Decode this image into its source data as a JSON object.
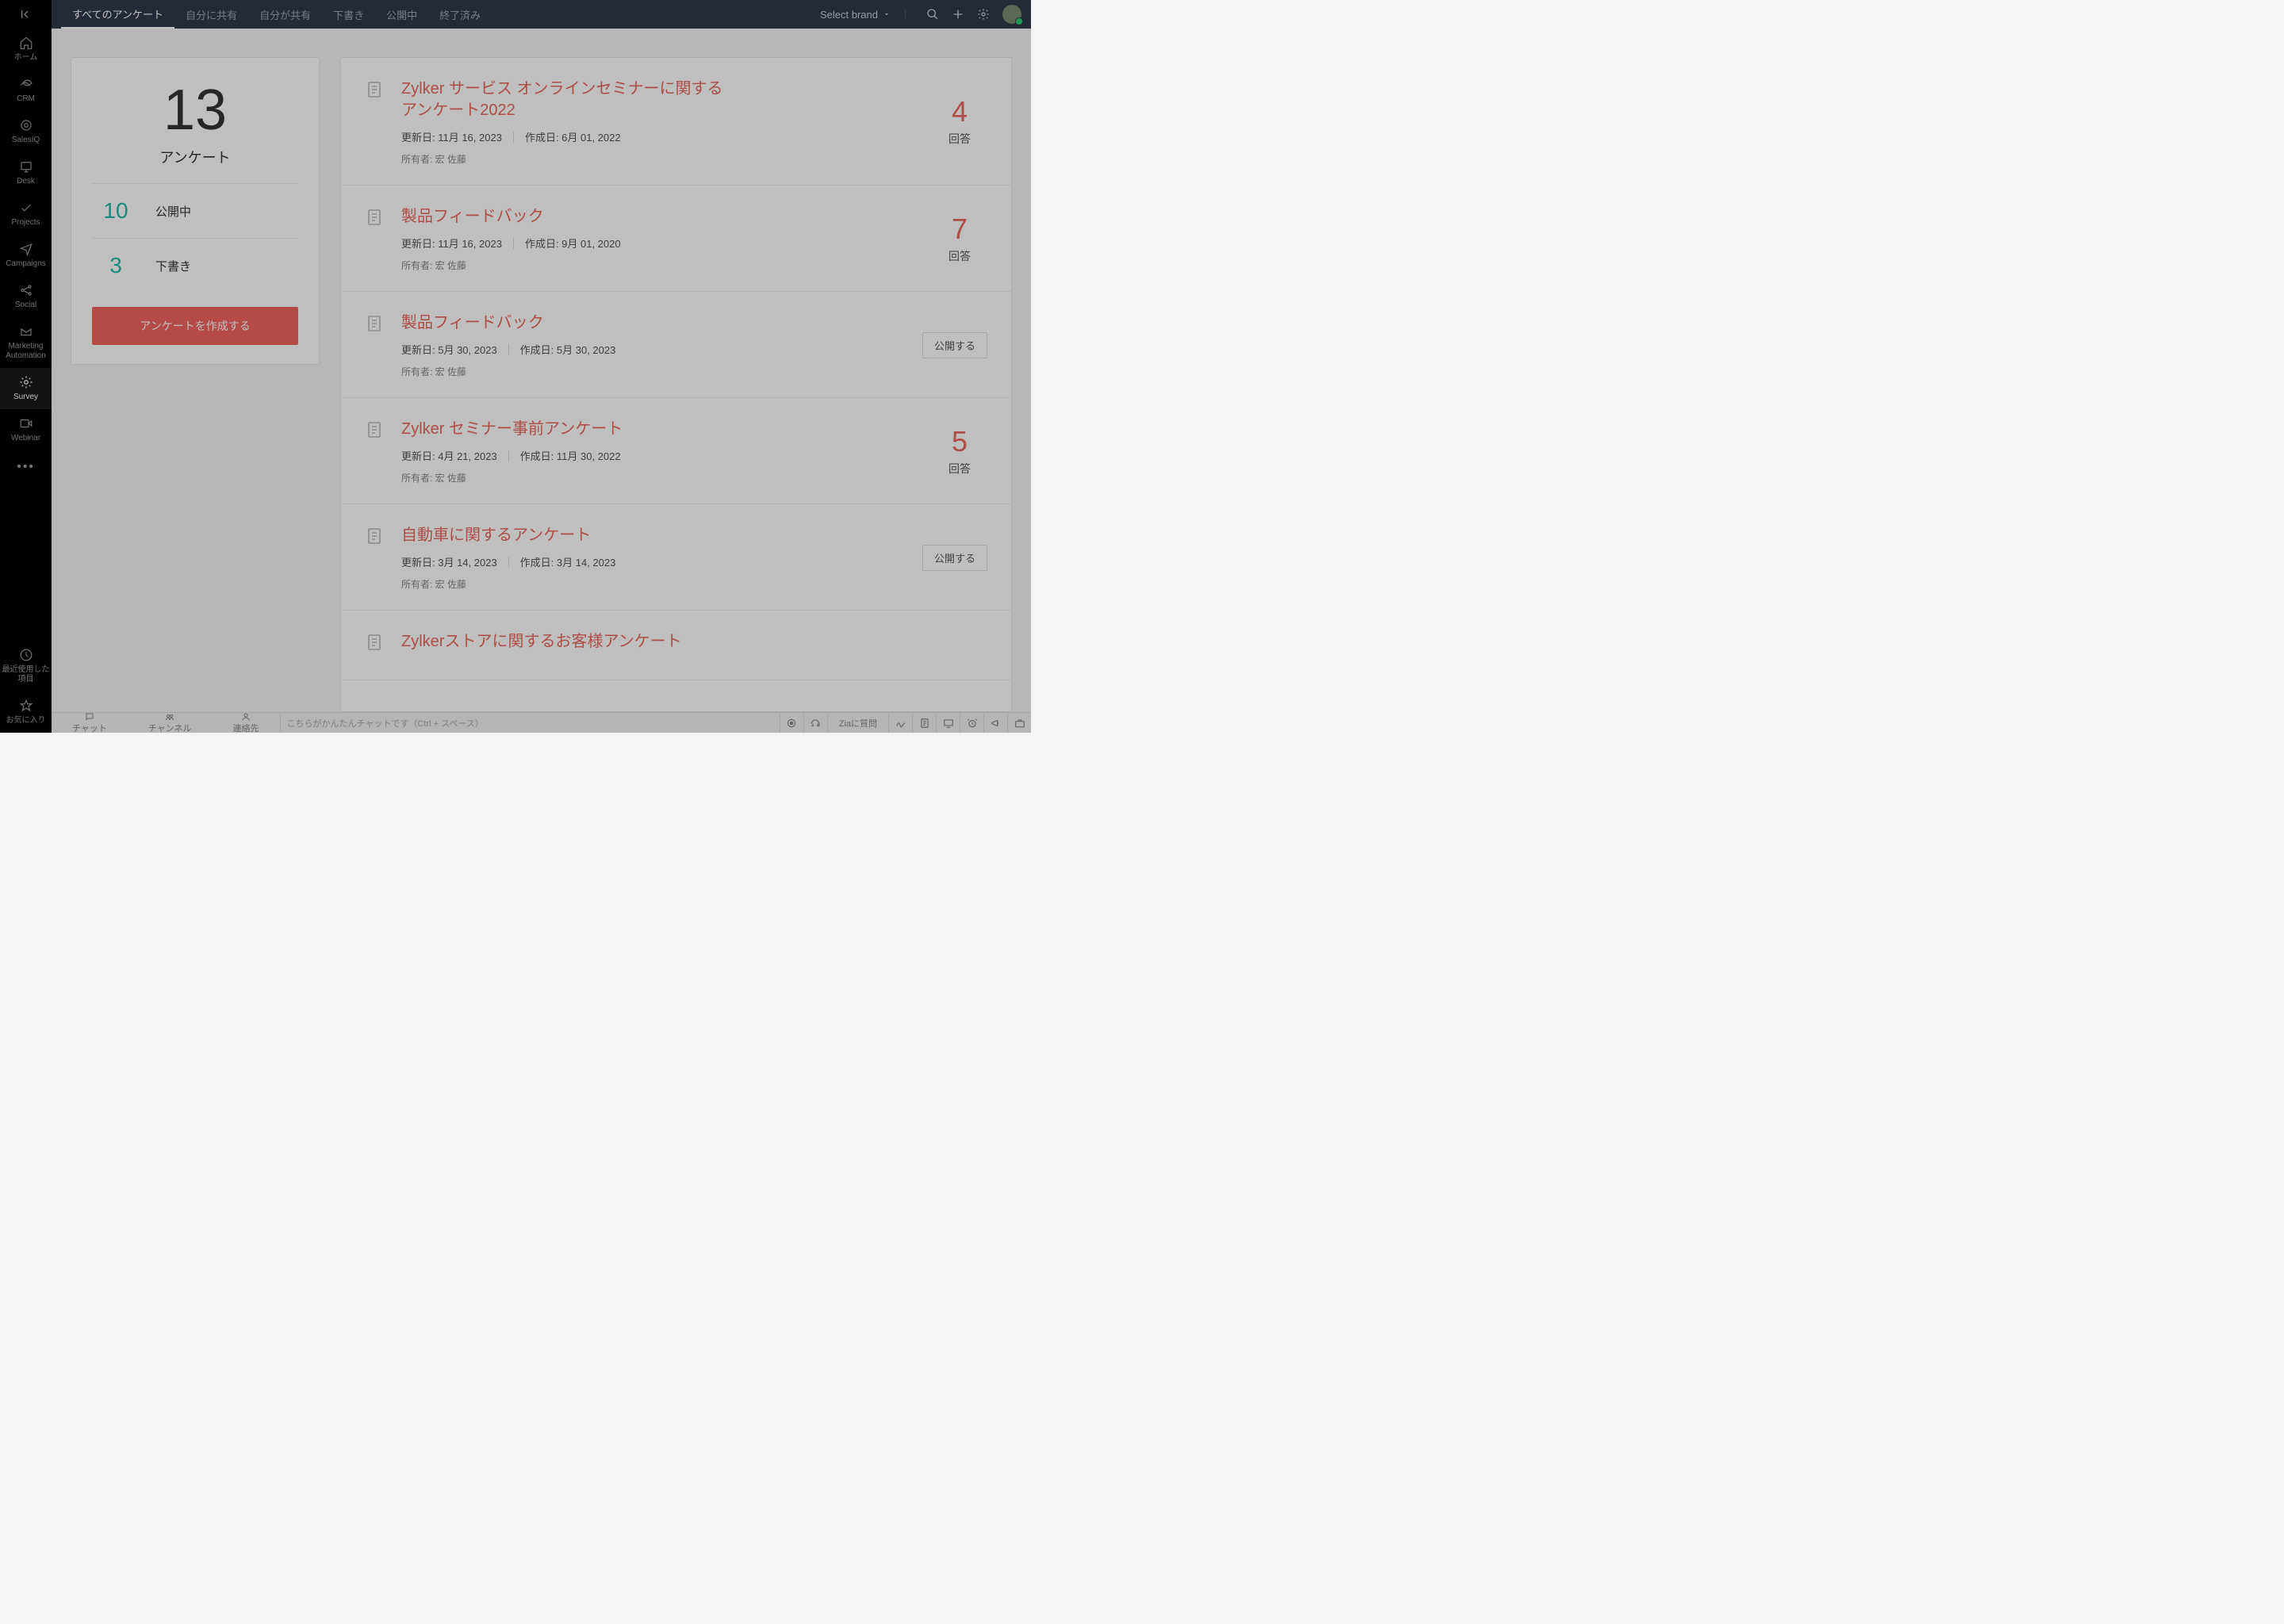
{
  "sidebar": {
    "items": [
      {
        "label": "ホーム"
      },
      {
        "label": "CRM"
      },
      {
        "label": "SalesIQ"
      },
      {
        "label": "Desk"
      },
      {
        "label": "Projects"
      },
      {
        "label": "Campaigns"
      },
      {
        "label": "Social"
      },
      {
        "label": "Marketing Automation"
      },
      {
        "label": "Survey"
      },
      {
        "label": "Webinar"
      }
    ],
    "recent": "最近使用した項目",
    "favorites": "お気に入り"
  },
  "tabs": {
    "all": "すべてのアンケート",
    "shared_with_me": "自分に共有",
    "shared_by_me": "自分が共有",
    "draft": "下書き",
    "published": "公開中",
    "closed": "終了済み"
  },
  "header": {
    "brand_select": "Select brand"
  },
  "summary": {
    "total": "13",
    "total_label": "アンケート",
    "published_count": "10",
    "published_label": "公開中",
    "draft_count": "3",
    "draft_label": "下書き",
    "create_button": "アンケートを作成する"
  },
  "labels": {
    "updated_prefix": "更新日: ",
    "created_prefix": "作成日: ",
    "owner_prefix": "所有者:  ",
    "responses": "回答",
    "publish": "公開する"
  },
  "surveys": [
    {
      "title": "Zylker サービス オンラインセミナーに関するアンケート2022",
      "updated": "11月 16, 2023",
      "created": "6月 01, 2022",
      "owner": "宏 佐藤",
      "responses": "4"
    },
    {
      "title": "製品フィードバック",
      "updated": "11月 16, 2023",
      "created": "9月 01, 2020",
      "owner": "宏 佐藤",
      "responses": "7"
    },
    {
      "title": "製品フィードバック",
      "updated": "5月 30, 2023",
      "created": "5月 30, 2023",
      "owner": "宏 佐藤",
      "responses": null,
      "draft": true
    },
    {
      "title": "Zylker セミナー事前アンケート",
      "updated": "4月 21, 2023",
      "created": "11月 30, 2022",
      "owner": "宏 佐藤",
      "responses": "5"
    },
    {
      "title": "自動車に関するアンケート",
      "updated": "3月 14, 2023",
      "created": "3月 14, 2023",
      "owner": "宏 佐藤",
      "responses": null,
      "draft": true
    },
    {
      "title": "Zylkerストアに関するお客様アンケート",
      "updated": "",
      "created": "",
      "owner": "",
      "responses": null
    }
  ],
  "bottombar": {
    "chat": "チャット",
    "channel": "チャンネル",
    "contacts": "連絡先",
    "chat_placeholder": "こちらがかんたんチャットです（Ctrl + スペース）",
    "zia": "Ziaに質問"
  }
}
